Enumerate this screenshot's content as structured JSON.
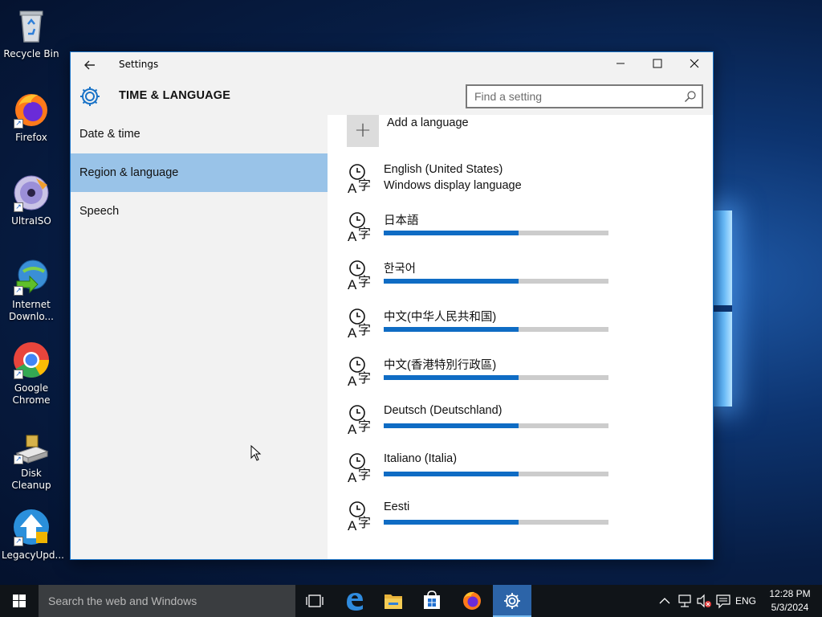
{
  "desktop": {
    "icons": [
      {
        "label": "Recycle Bin",
        "icon": "recycle-bin-icon"
      },
      {
        "label": "Firefox",
        "icon": "firefox-icon"
      },
      {
        "label": "UltraISO",
        "icon": "ultraiso-icon"
      },
      {
        "label": "Internet Downlo...",
        "icon": "internet-download-manager-icon"
      },
      {
        "label": "Google Chrome",
        "icon": "chrome-icon"
      },
      {
        "label": "Disk Cleanup",
        "icon": "disk-cleanup-icon"
      },
      {
        "label": "LegacyUpd...",
        "icon": "legacy-update-icon"
      }
    ]
  },
  "window": {
    "title": "Settings",
    "section": "TIME & LANGUAGE",
    "search_placeholder": "Find a setting",
    "sidebar": [
      {
        "label": "Date & time",
        "active": false
      },
      {
        "label": "Region & language",
        "active": true
      },
      {
        "label": "Speech",
        "active": false
      }
    ],
    "add_language_label": "Add a language",
    "languages": [
      {
        "name": "English (United States)",
        "subtitle": "Windows display language",
        "progress": null
      },
      {
        "name": "日本語",
        "subtitle": null,
        "progress": 0.6
      },
      {
        "name": "한국어",
        "subtitle": null,
        "progress": 0.6
      },
      {
        "name": "中文(中华人民共和国)",
        "subtitle": null,
        "progress": 0.6
      },
      {
        "name": "中文(香港特別行政區)",
        "subtitle": null,
        "progress": 0.6
      },
      {
        "name": "Deutsch (Deutschland)",
        "subtitle": null,
        "progress": 0.6
      },
      {
        "name": "Italiano (Italia)",
        "subtitle": null,
        "progress": 0.6
      },
      {
        "name": "Eesti",
        "subtitle": null,
        "progress": 0.6
      }
    ]
  },
  "taskbar": {
    "search_placeholder": "Search the web and Windows",
    "apps": [
      "task-view-icon",
      "edge-icon",
      "file-explorer-icon",
      "store-icon",
      "firefox-icon",
      "settings-icon"
    ],
    "language": "ENG",
    "time": "12:28 PM",
    "date": "5/3/2024"
  },
  "colors": {
    "accent": "#0f6cc4",
    "sidebar_active": "#99c3e8",
    "taskbar": "#101418"
  }
}
